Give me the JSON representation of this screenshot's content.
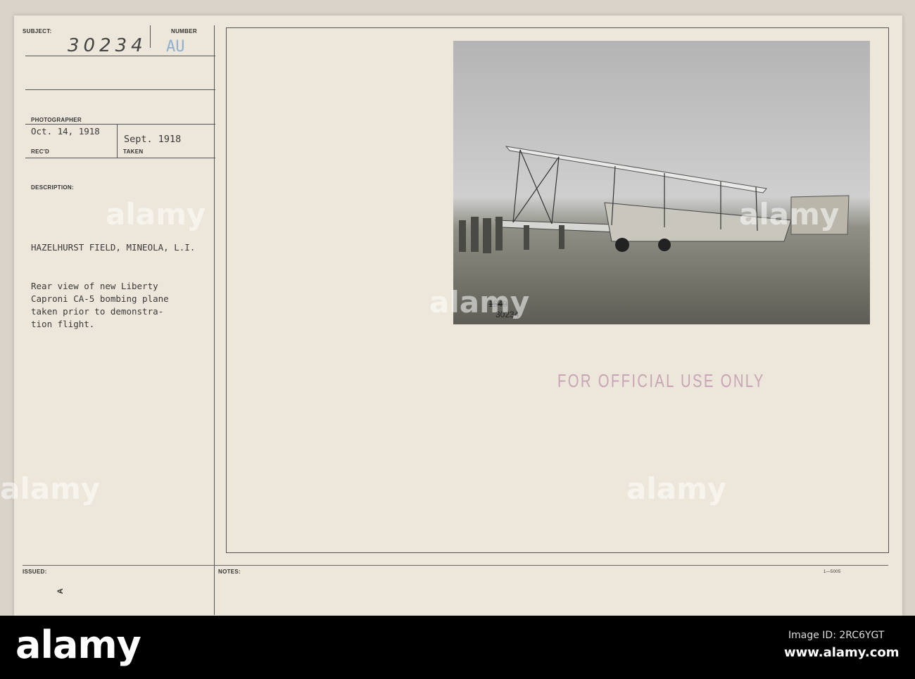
{
  "card": {
    "subject_label": "SUBJECT:",
    "number_label": "NUMBER",
    "subject_number": "30234",
    "number_code": "AU",
    "photographer_label": "PHOTOGRAPHER",
    "recd_date": "Oct. 14, 1918",
    "recd_label": "REC'D",
    "taken_date": "Sept. 1918",
    "taken_label": "TAKEN",
    "description_label": "DESCRIPTION:",
    "location": "HAZELHURST FIELD, MINEOLA, L.I.",
    "description_lines": [
      "Rear view of new Liberty",
      "Caproni CA-5 bombing plane",
      "taken prior to demonstra-",
      "tion flight."
    ],
    "issued_label": "ISSUED:",
    "issued_mark": "A",
    "notes_label": "NOTES:",
    "form_number": "1—5005",
    "stamp": "FOR OFFICIAL USE ONLY",
    "photo_numbers": [
      "1540",
      "30234"
    ]
  },
  "footer": {
    "logo": "alamy",
    "image_id": "Image ID: 2RC6YGT",
    "url": "www.alamy.com"
  },
  "watermark": "alamy"
}
